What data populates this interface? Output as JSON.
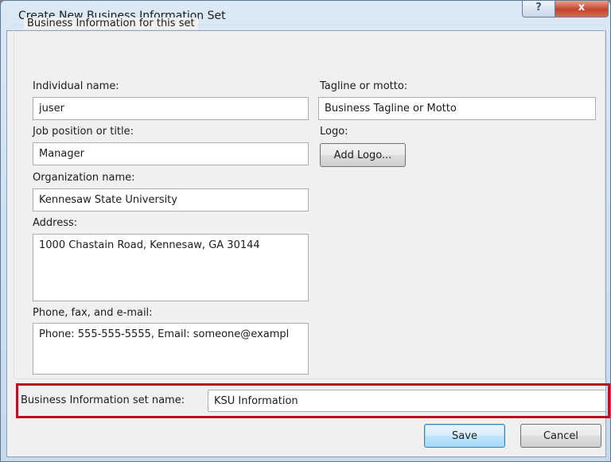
{
  "window": {
    "title": "Create New Business Information Set",
    "help_glyph": "?",
    "close_glyph": "x"
  },
  "group": {
    "legend": "Business Information for this set"
  },
  "fields": {
    "individual_name": {
      "label": "Individual name:",
      "value": "juser"
    },
    "job_title": {
      "label": "Job position or title:",
      "value": "Manager"
    },
    "organization": {
      "label": "Organization name:",
      "value": "Kennesaw State University"
    },
    "address": {
      "label": "Address:",
      "value": "1000 Chastain Road, Kennesaw, GA 30144"
    },
    "contact": {
      "label": "Phone, fax, and e-mail:",
      "value": "Phone: 555-555-5555, Email: someone@exampl"
    },
    "tagline": {
      "label": "Tagline or motto:",
      "value": "Business Tagline or Motto"
    },
    "logo": {
      "label": "Logo:",
      "button": "Add Logo..."
    },
    "set_name": {
      "label": "Business Information set name:",
      "value": "KSU Information"
    }
  },
  "buttons": {
    "save": "Save",
    "cancel": "Cancel"
  },
  "colors": {
    "highlight": "#b8121b",
    "close_button": "#c3432a",
    "default_button": "#3c7fb1"
  }
}
